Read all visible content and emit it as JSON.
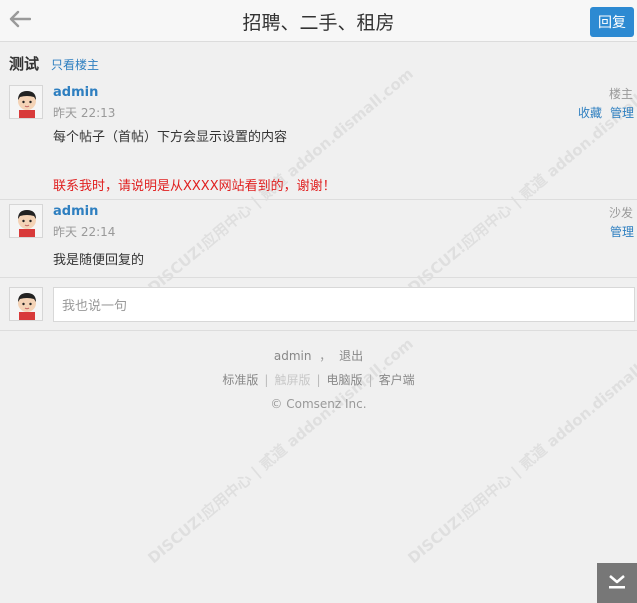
{
  "header": {
    "title": "招聘、二手、租房",
    "reply_label": "回复"
  },
  "thread": {
    "title": "测试",
    "only_author_label": "只看楼主"
  },
  "posts": [
    {
      "author": "admin",
      "time": "昨天 22:13",
      "floor": "楼主",
      "actions": [
        "收藏",
        "管理"
      ],
      "body_lines": [
        "每个帖子（首帖）下方会显示设置的内容",
        "联系我时，请说明是从XXXX网站看到的，谢谢！"
      ]
    },
    {
      "author": "admin",
      "time": "昨天 22:14",
      "floor": "沙发",
      "actions": [
        "管理"
      ],
      "body_lines": [
        "我是随便回复的"
      ]
    }
  ],
  "quick_reply": {
    "placeholder": "我也说一句"
  },
  "footer": {
    "user": "admin",
    "comma": "，",
    "logout": "退出",
    "links": [
      "标准版",
      "触屏版",
      "电脑版",
      "客户端"
    ],
    "copyright": "© Comsenz Inc."
  },
  "watermark_text": "DISCUZ!应用中心 | 贰道 addon.dismall.com",
  "colors": {
    "accent": "#2d8ad2",
    "link": "#2e7fc0",
    "highlight_text": "#e02020"
  },
  "icons": {
    "back": "arrow-left-icon",
    "avatar": "avatar-icon",
    "to_bottom": "scroll-to-bottom-icon"
  }
}
